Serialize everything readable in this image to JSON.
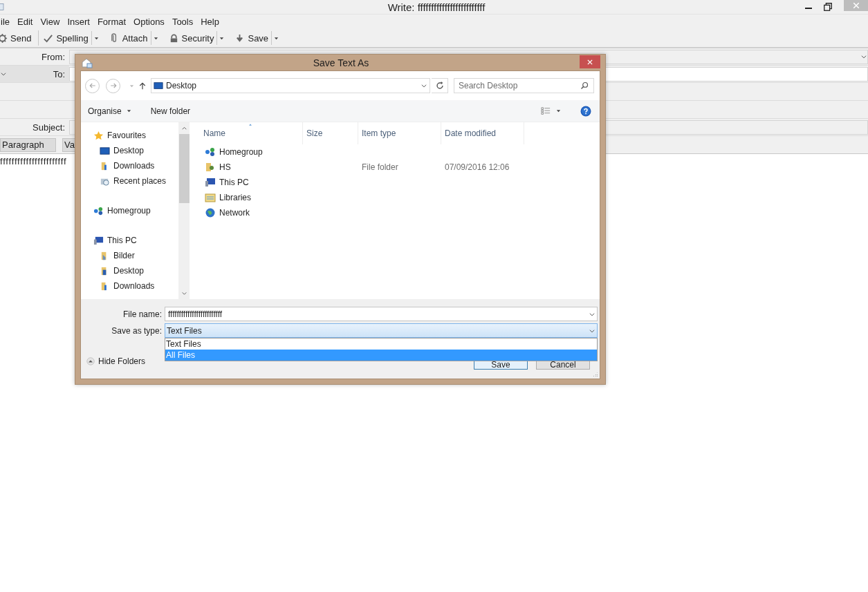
{
  "window": {
    "title": "Write: fffffffffffffffffffffffff",
    "menu": [
      "ile",
      "Edit",
      "View",
      "Insert",
      "Format",
      "Options",
      "Tools",
      "Help"
    ],
    "toolbar": [
      {
        "label": "Send",
        "dropdown": false
      },
      {
        "label": "Spelling",
        "dropdown": true
      },
      {
        "label": "Attach",
        "dropdown": true
      },
      {
        "label": "Security",
        "dropdown": true
      },
      {
        "label": "Save",
        "dropdown": true
      }
    ]
  },
  "compose": {
    "from_label": "From:",
    "to_label": "To:",
    "subject_label": "Subject:",
    "paragraph_select": "Paragraph",
    "font_select": "Va",
    "body_text": "fffffffffffffffffffffff"
  },
  "dialog": {
    "title": "Save Text As",
    "address": "Desktop",
    "search": {
      "placeholder": "Search Desktop"
    },
    "organise": "Organise",
    "new_folder": "New folder",
    "nav_tree": [
      {
        "label": "Favourites",
        "kind": "star",
        "children": [
          {
            "label": "Desktop",
            "kind": "desktop"
          },
          {
            "label": "Downloads",
            "kind": "downloads"
          },
          {
            "label": "Recent places",
            "kind": "recent"
          }
        ]
      },
      {
        "label": "Homegroup",
        "kind": "homegroup"
      },
      {
        "label": "This PC",
        "kind": "pc",
        "children": [
          {
            "label": "Bilder",
            "kind": "pictures"
          },
          {
            "label": "Desktop",
            "kind": "folder"
          },
          {
            "label": "Downloads",
            "kind": "downloads"
          }
        ]
      }
    ],
    "columns": [
      {
        "label": "Name",
        "sorted": true
      },
      {
        "label": "Size",
        "sorted": false
      },
      {
        "label": "Item type",
        "sorted": false
      },
      {
        "label": "Date modified",
        "sorted": false
      }
    ],
    "files": [
      {
        "name": "Homegroup",
        "kind": "homegroup"
      },
      {
        "name": "HS",
        "kind": "user",
        "item_type": "File folder",
        "date_modified": "07/09/2016 12:06"
      },
      {
        "name": "This PC",
        "kind": "pc"
      },
      {
        "name": "Libraries",
        "kind": "library"
      },
      {
        "name": "Network",
        "kind": "network"
      }
    ],
    "file_name_label": "File name:",
    "file_name": "fffffffffffffffffffffffff",
    "save_type_label": "Save as type:",
    "save_type": "Text Files",
    "type_options": [
      {
        "label": "Text Files",
        "selected": false
      },
      {
        "label": "All Files",
        "selected": true
      }
    ],
    "hide_folders": "Hide Folders",
    "save_button": "Save",
    "cancel_button": "Cancel"
  }
}
